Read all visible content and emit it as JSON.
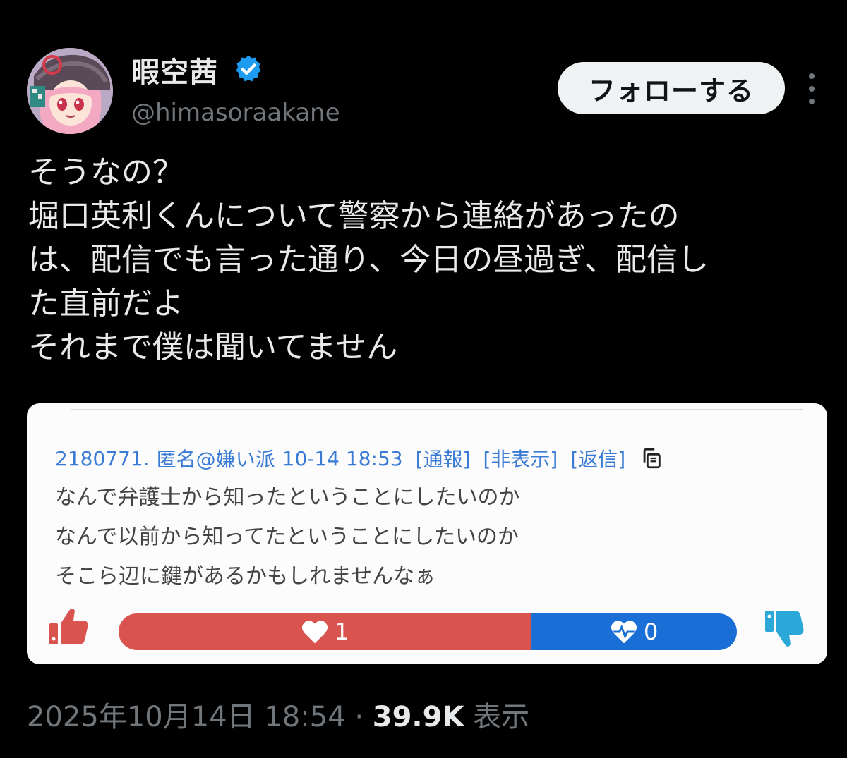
{
  "author": {
    "display_name": "暇空茜",
    "handle": "@himasoraakane",
    "verified": true
  },
  "follow_button_label": "フォローする",
  "tweet": {
    "lines": [
      "そうなの？",
      "堀口英利くんについて警察から連絡があったの",
      "は、配信でも言った通り、今日の昼過ぎ、配信し",
      "た直前だよ",
      "それまで僕は聞いてません"
    ]
  },
  "embedded_post": {
    "id": "2180771.",
    "name": "匿名@嫌い派",
    "datetime": "10-14 18:53",
    "report_label": "[通報]",
    "hide_label": "[非表示]",
    "reply_label": "[返信]",
    "body_lines": [
      "なんで弁護士から知ったということにしたいのか",
      "なんで以前から知ってたということにしたいのか",
      "そこら辺に鍵があるかもしれませんなぁ"
    ],
    "votes": {
      "good": "1",
      "bad": "0",
      "good_fraction": 0.667
    }
  },
  "meta": {
    "date": "2025年10月14日 18:54",
    "separator": "·",
    "views_count": "39.9K",
    "views_label": "表示"
  },
  "colors": {
    "background": "#000000",
    "verified_blue": "#1d9bf0",
    "good_red": "#d9534f",
    "bad_blue": "#1a6fd6",
    "link_blue": "#3a7bd5"
  },
  "icons": [
    "verified-badge-icon",
    "more-menu-icon",
    "copy-icon",
    "thumbs-up-icon",
    "heart-icon",
    "heartbeat-icon",
    "thumbs-down-icon"
  ]
}
